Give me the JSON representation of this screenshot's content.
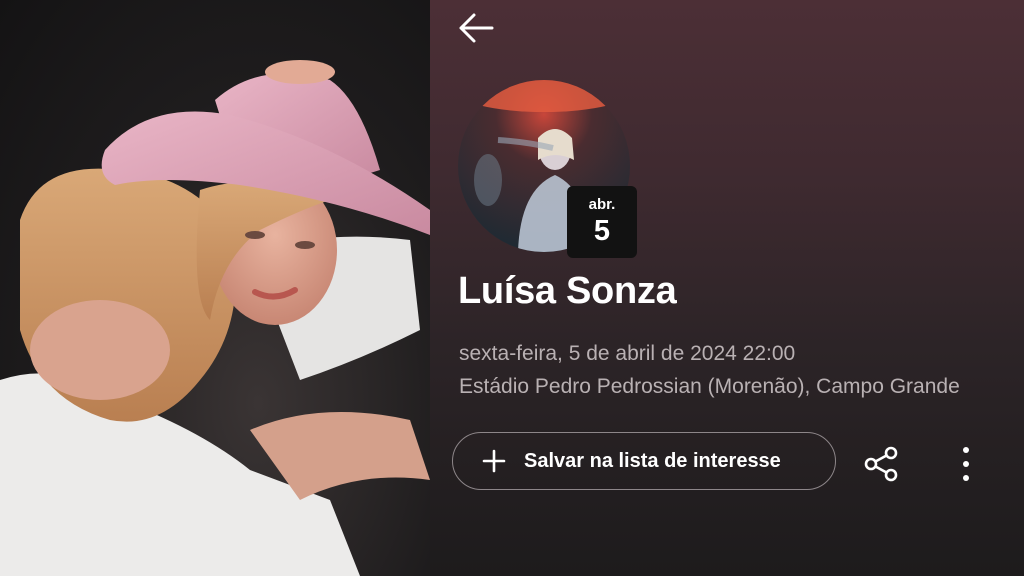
{
  "photo": {
    "icon": "artist-photo"
  },
  "header": {
    "back_icon": "arrow-left-icon"
  },
  "event": {
    "month": "abr.",
    "day": "5",
    "artist": "Luísa Sonza",
    "datetime": "sexta-feira, 5 de abril de 2024 22:00",
    "venue": "Estádio Pedro Pedrossian (Morenão), Campo Grande"
  },
  "actions": {
    "save_label": "Salvar na lista de interesse",
    "save_icon": "plus-icon",
    "share_icon": "share-icon",
    "more_icon": "more-vertical-icon"
  },
  "colors": {
    "panel_top": "#4c2f36",
    "panel_bottom": "#1d1b1c",
    "secondary_text": "#b9b1b3",
    "badge_bg": "#121212",
    "button_border": "#8d8689"
  }
}
